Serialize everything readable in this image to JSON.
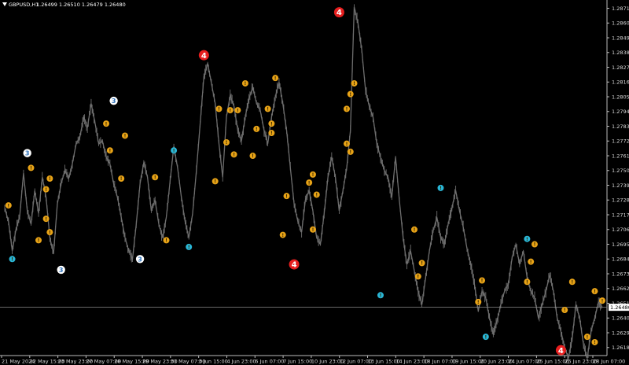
{
  "header": {
    "symbol": "GBPUSD,H1",
    "ohlc": "1.26499 1.26510 1.26479 1.26480"
  },
  "colors": {
    "background": "#000000",
    "price": "#6e6e6e",
    "grid_line": "#8a8a8a",
    "axis_label": "#d8d8d8",
    "marker_orange": "#e8a317",
    "marker_cyan": "#29b6d6",
    "marker_white": "#ffffff",
    "marker_red": "#e61e1e"
  },
  "chart_data": {
    "type": "line",
    "ylim": [
      1.2612,
      1.2876
    ],
    "y_ticks": [
      "1.28710",
      "1.28600",
      "1.28490",
      "1.28380",
      "1.28270",
      "1.28160",
      "1.28050",
      "1.27940",
      "1.27830",
      "1.27720",
      "1.27610",
      "1.27500",
      "1.27390",
      "1.27280",
      "1.27170",
      "1.27060",
      "1.26950",
      "1.26840",
      "1.26730",
      "1.26620",
      "1.26510",
      "1.26400",
      "1.26290",
      "1.26180"
    ],
    "x_ticks": [
      "21 May 2024",
      "22 May 15:00",
      "23 May 23:00",
      "27 May 07:00",
      "28 May 15:00",
      "29 May 23:00",
      "31 May 07:00",
      "3 Jun 15:00",
      "4 Jun 23:00",
      "6 Jun 07:00",
      "7 Jun 15:00",
      "10 Jun 23:00",
      "12 Jun 07:00",
      "13 Jun 15:00",
      "14 Jun 23:00",
      "18 Jun 07:00",
      "19 Jun 15:00",
      "20 Jun 23:00",
      "24 Jun 07:00",
      "25 Jun 15:00",
      "26 Jun 23:00",
      "28 Jun 07:00"
    ],
    "current_price": 1.2648,
    "current_price_label": "1.26480",
    "series": [
      {
        "values": [
          1.2722,
          1.2712,
          1.269,
          1.2706,
          1.2716,
          1.2748,
          1.272,
          1.271,
          1.2735,
          1.2718,
          1.2745,
          1.273,
          1.27,
          1.2688,
          1.2725,
          1.274,
          1.275,
          1.2744,
          1.2755,
          1.277,
          1.2775,
          1.279,
          1.2782,
          1.28,
          1.2786,
          1.277,
          1.2772,
          1.276,
          1.2755,
          1.274,
          1.273,
          1.2715,
          1.27,
          1.269,
          1.2684,
          1.271,
          1.274,
          1.2756,
          1.2745,
          1.272,
          1.2728,
          1.271,
          1.27,
          1.2715,
          1.2742,
          1.2768,
          1.2752,
          1.273,
          1.2712,
          1.27,
          1.2718,
          1.275,
          1.2785,
          1.282,
          1.283,
          1.2815,
          1.28,
          1.277,
          1.2745,
          1.279,
          1.2806,
          1.2798,
          1.278,
          1.2772,
          1.279,
          1.2804,
          1.2812,
          1.28,
          1.2795,
          1.278,
          1.277,
          1.279,
          1.2805,
          1.2816,
          1.28,
          1.278,
          1.2752,
          1.2725,
          1.2712,
          1.2704,
          1.2728,
          1.2735,
          1.272,
          1.27,
          1.2695,
          1.2718,
          1.2745,
          1.276,
          1.2745,
          1.272,
          1.2735,
          1.2752,
          1.278,
          1.2872,
          1.286,
          1.284,
          1.281,
          1.2798,
          1.279,
          1.277,
          1.276,
          1.275,
          1.2745,
          1.273,
          1.276,
          1.2728,
          1.27,
          1.268,
          1.269,
          1.2675,
          1.266,
          1.265,
          1.267,
          1.269,
          1.2705,
          1.2715,
          1.27,
          1.2695,
          1.271,
          1.2722,
          1.2735,
          1.272,
          1.2708,
          1.2692,
          1.268,
          1.2665,
          1.2645,
          1.266,
          1.2655,
          1.264,
          1.2628,
          1.2638,
          1.265,
          1.266,
          1.2665,
          1.2685,
          1.2695,
          1.268,
          1.269,
          1.267,
          1.266,
          1.2655,
          1.264,
          1.265,
          1.266,
          1.2672,
          1.266,
          1.264,
          1.263,
          1.2618,
          1.261,
          1.2625,
          1.265,
          1.264,
          1.262,
          1.261,
          1.263,
          1.264,
          1.2652,
          1.2648
        ]
      }
    ]
  },
  "markers": [
    {
      "label": "!",
      "color": "orange",
      "i": 1,
      "v": 1.2724
    },
    {
      "label": "!",
      "color": "cyan",
      "i": 2,
      "v": 1.2684
    },
    {
      "label": "3",
      "color": "white",
      "i": 6,
      "v": 1.2763
    },
    {
      "label": "!",
      "color": "orange",
      "i": 7,
      "v": 1.2752
    },
    {
      "label": "!",
      "color": "orange",
      "i": 9,
      "v": 1.2698
    },
    {
      "label": "!",
      "color": "orange",
      "i": 11,
      "v": 1.2736
    },
    {
      "label": "!",
      "color": "orange",
      "i": 12,
      "v": 1.2744
    },
    {
      "label": "!",
      "color": "orange",
      "i": 11,
      "v": 1.2714
    },
    {
      "label": "!",
      "color": "orange",
      "i": 12,
      "v": 1.2704
    },
    {
      "label": "3",
      "color": "white",
      "i": 15,
      "v": 1.2676
    },
    {
      "label": "!",
      "color": "orange",
      "i": 27,
      "v": 1.2785
    },
    {
      "label": "!",
      "color": "orange",
      "i": 28,
      "v": 1.2765
    },
    {
      "label": "3",
      "color": "white",
      "i": 29,
      "v": 1.2802
    },
    {
      "label": "!",
      "color": "orange",
      "i": 32,
      "v": 1.2776
    },
    {
      "label": "!",
      "color": "orange",
      "i": 31,
      "v": 1.2744
    },
    {
      "label": "3",
      "color": "white",
      "i": 36,
      "v": 1.2684
    },
    {
      "label": "!",
      "color": "orange",
      "i": 40,
      "v": 1.2745
    },
    {
      "label": "!",
      "color": "orange",
      "i": 43,
      "v": 1.2698
    },
    {
      "label": "!",
      "color": "cyan",
      "i": 45,
      "v": 1.2765
    },
    {
      "label": "!",
      "color": "cyan",
      "i": 49,
      "v": 1.2693
    },
    {
      "label": "4",
      "color": "red",
      "i": 53,
      "v": 1.2836
    },
    {
      "label": "!",
      "color": "orange",
      "i": 56,
      "v": 1.2742
    },
    {
      "label": "!",
      "color": "orange",
      "i": 57,
      "v": 1.2796
    },
    {
      "label": "!",
      "color": "orange",
      "i": 59,
      "v": 1.2771
    },
    {
      "label": "!",
      "color": "orange",
      "i": 60,
      "v": 1.2795
    },
    {
      "label": "!",
      "color": "orange",
      "i": 61,
      "v": 1.2762
    },
    {
      "label": "!",
      "color": "orange",
      "i": 62,
      "v": 1.2795
    },
    {
      "label": "!",
      "color": "orange",
      "i": 64,
      "v": 1.2815
    },
    {
      "label": "!",
      "color": "orange",
      "i": 66,
      "v": 1.2761
    },
    {
      "label": "!",
      "color": "orange",
      "i": 67,
      "v": 1.2781
    },
    {
      "label": "!",
      "color": "orange",
      "i": 70,
      "v": 1.2796
    },
    {
      "label": "!",
      "color": "orange",
      "i": 71,
      "v": 1.2785
    },
    {
      "label": "!",
      "color": "orange",
      "i": 71,
      "v": 1.2778
    },
    {
      "label": "!",
      "color": "orange",
      "i": 72,
      "v": 1.2819
    },
    {
      "label": "!",
      "color": "orange",
      "i": 75,
      "v": 1.2731
    },
    {
      "label": "!",
      "color": "orange",
      "i": 74,
      "v": 1.2702
    },
    {
      "label": "4",
      "color": "red",
      "i": 77,
      "v": 1.268
    },
    {
      "label": "!",
      "color": "orange",
      "i": 81,
      "v": 1.2741
    },
    {
      "label": "!",
      "color": "orange",
      "i": 82,
      "v": 1.2747
    },
    {
      "label": "!",
      "color": "orange",
      "i": 82,
      "v": 1.2706
    },
    {
      "label": "!",
      "color": "orange",
      "i": 83,
      "v": 1.2732
    },
    {
      "label": "4",
      "color": "red",
      "i": 89,
      "v": 1.2868
    },
    {
      "label": "!",
      "color": "orange",
      "i": 93,
      "v": 1.2815
    },
    {
      "label": "!",
      "color": "orange",
      "i": 92,
      "v": 1.2807
    },
    {
      "label": "!",
      "color": "orange",
      "i": 91,
      "v": 1.2796
    },
    {
      "label": "!",
      "color": "orange",
      "i": 91,
      "v": 1.277
    },
    {
      "label": "!",
      "color": "orange",
      "i": 92,
      "v": 1.2764
    },
    {
      "label": "!",
      "color": "cyan",
      "i": 100,
      "v": 1.2657
    },
    {
      "label": "!",
      "color": "orange",
      "i": 109,
      "v": 1.2706
    },
    {
      "label": "!",
      "color": "orange",
      "i": 111,
      "v": 1.2681
    },
    {
      "label": "!",
      "color": "orange",
      "i": 110,
      "v": 1.2671
    },
    {
      "label": "!",
      "color": "cyan",
      "i": 116,
      "v": 1.2737
    },
    {
      "label": "!",
      "color": "orange",
      "i": 126,
      "v": 1.2652
    },
    {
      "label": "!",
      "color": "orange",
      "i": 127,
      "v": 1.2668
    },
    {
      "label": "!",
      "color": "cyan",
      "i": 128,
      "v": 1.2626
    },
    {
      "label": "!",
      "color": "cyan",
      "i": 139,
      "v": 1.2699
    },
    {
      "label": "!",
      "color": "orange",
      "i": 140,
      "v": 1.2682
    },
    {
      "label": "!",
      "color": "orange",
      "i": 141,
      "v": 1.2695
    },
    {
      "label": "!",
      "color": "orange",
      "i": 139,
      "v": 1.2667
    },
    {
      "label": "!",
      "color": "orange",
      "i": 151,
      "v": 1.2667
    },
    {
      "label": "!",
      "color": "orange",
      "i": 149,
      "v": 1.2646
    },
    {
      "label": "4",
      "color": "red",
      "i": 148,
      "v": 1.2616
    },
    {
      "label": "!",
      "color": "orange",
      "i": 155,
      "v": 1.2626
    },
    {
      "label": "!",
      "color": "orange",
      "i": 157,
      "v": 1.2622
    },
    {
      "label": "!",
      "color": "orange",
      "i": 157,
      "v": 1.266
    },
    {
      "label": "!",
      "color": "orange",
      "i": 159,
      "v": 1.2653
    }
  ]
}
